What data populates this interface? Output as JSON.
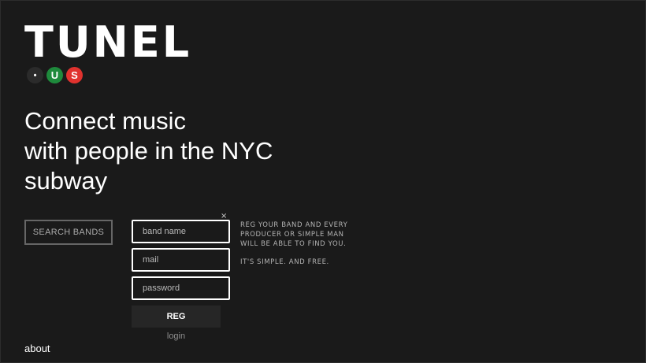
{
  "brand": {
    "logo_text": "TUNEL",
    "badges": [
      {
        "label": "•",
        "color": "#2b2b2b",
        "icon": "dot-icon"
      },
      {
        "label": "U",
        "color": "#1e8a3c",
        "icon": "u-line-icon"
      },
      {
        "label": "S",
        "color": "#e0322e",
        "icon": "s-line-icon"
      }
    ]
  },
  "hero": {
    "lines": [
      "Connect music",
      "with people in the NYC",
      "subway"
    ]
  },
  "actions": {
    "search_label": "SEARCH BANDS"
  },
  "register_form": {
    "close_symbol": "×",
    "band_name_placeholder": "band name",
    "mail_placeholder": "mail",
    "password_placeholder": "password",
    "submit_label": "REG",
    "login_label": "login"
  },
  "info": {
    "paragraph1": "REG YOUR BAND AND EVERY PRODUCER OR SIMPLE MAN WILL BE ABLE TO FIND YOU.",
    "paragraph2": "IT'S SIMPLE. AND FREE."
  },
  "footer": {
    "about_label": "about"
  },
  "colors": {
    "background": "#1a1a1a",
    "accent_green": "#1e8a3c",
    "accent_red": "#e0322e"
  }
}
